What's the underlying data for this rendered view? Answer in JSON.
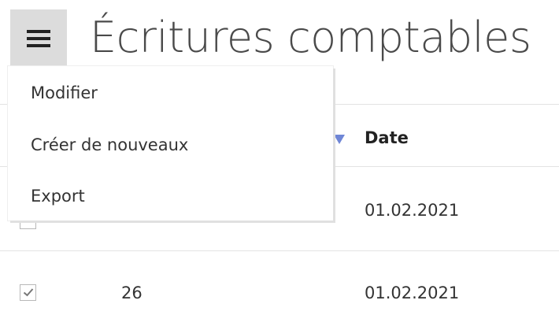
{
  "header": {
    "menu_icon": "hamburger-icon",
    "title": "Écritures comptables"
  },
  "menu": {
    "items": [
      {
        "label": "Modifier"
      },
      {
        "label": "Créer de nouveaux"
      },
      {
        "label": "Export"
      }
    ]
  },
  "table": {
    "columns": [
      {
        "label": "Date",
        "sort": "descending"
      }
    ],
    "rows": [
      {
        "checked": false,
        "number": "",
        "date": "01.02.2021"
      },
      {
        "checked": true,
        "number": "26",
        "date": "01.02.2021"
      }
    ]
  },
  "colors": {
    "menu_button_bg": "#dcdcdc",
    "sort_arrow": "#6f86d6",
    "divider": "#e3e3e3"
  }
}
